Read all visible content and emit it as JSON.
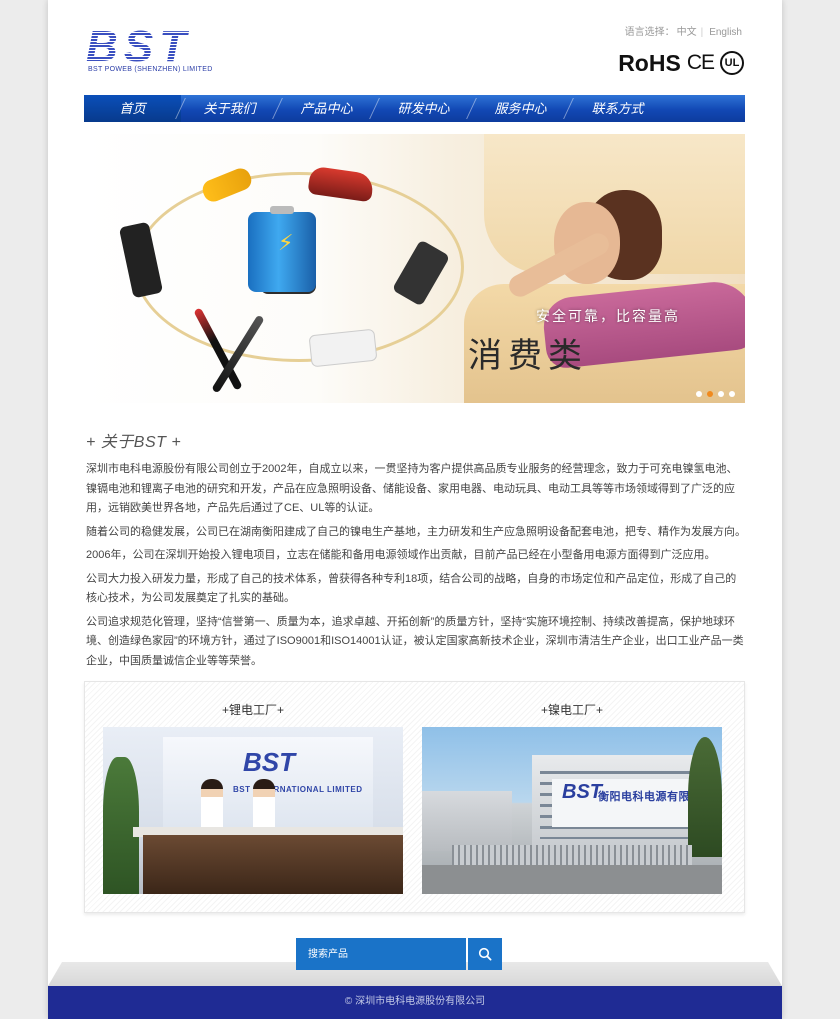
{
  "header": {
    "logo_text": "BST",
    "logo_subtitle": "BST POWEB (SHENZHEN) LIMITED",
    "language_label": "语言选择：",
    "language_options": [
      "中文",
      "English"
    ],
    "certifications": {
      "rohs": "RoHS",
      "ce": "CE",
      "ul": "UL"
    }
  },
  "nav": {
    "items": [
      {
        "label": "首页",
        "active": true
      },
      {
        "label": "关于我们",
        "active": false
      },
      {
        "label": "产品中心",
        "active": false
      },
      {
        "label": "研发中心",
        "active": false
      },
      {
        "label": "服务中心",
        "active": false
      },
      {
        "label": "联系方式",
        "active": false
      }
    ]
  },
  "banner": {
    "slogan": "安全可靠，比容量高",
    "title": "消费类",
    "slide_count": 4,
    "active_slide": 2
  },
  "about": {
    "title": "+ 关于BST +",
    "paragraphs": [
      "深圳市电科电源股份有限公司创立于2002年，自成立以来，一贯坚持为客户提供高品质专业服务的经营理念，致力于可充电镍氢电池、镍镉电池和锂离子电池的研究和开发，产品在应急照明设备、储能设备、家用电器、电动玩具、电动工具等等市场领域得到了广泛的应用，远销欧美世界各地，产品先后通过了CE、UL等的认证。",
      "随着公司的稳健发展，公司已在湖南衡阳建成了自己的镍电生产基地，主力研发和生产应急照明设备配套电池，把专、精作为发展方向。",
      "2006年，公司在深圳开始投入锂电项目，立志在储能和备用电源领域作出贡献，目前产品已经在小型备用电源方面得到广泛应用。",
      "公司大力投入研发力量，形成了自己的技术体系，曾获得各种专利18项，结合公司的战略，自身的市场定位和产品定位，形成了自己的核心技术，为公司发展奠定了扎实的基础。",
      "公司追求规范化管理，坚持“信誉第一、质量为本，追求卓越、开拓创新”的质量方针，坚持“实施环境控制、持续改善提高，保护地球环境、创造绿色家园”的环境方针，通过了ISO9001和ISO14001认证，被认定国家高新技术企业，深圳市清洁生产企业，出口工业产品一类企业，中国质量诚信企业等等荣誉。"
    ]
  },
  "factories": [
    {
      "title": "+锂电工厂+",
      "sign_brand": "BST",
      "sign_text": "电科电源(深圳) 有限公司",
      "sign_sub": "BST INTERNATIONAL LIMITED"
    },
    {
      "title": "+镍电工厂+",
      "sign_brand": "BST",
      "sign_text": "衡阳电科电源有限公司"
    }
  ],
  "search": {
    "placeholder": "搜索产品",
    "value": ""
  },
  "footer": {
    "copyright": "© 深圳市电科电源股份有限公司"
  },
  "colors": {
    "brand_blue": "#2d3fa8",
    "nav_blue": "#1248b4",
    "search_blue": "#1a73c8",
    "footer_navy": "#1f2b94",
    "active_dot": "#f08a1e"
  },
  "icons": {
    "search_button": "search-icon"
  }
}
